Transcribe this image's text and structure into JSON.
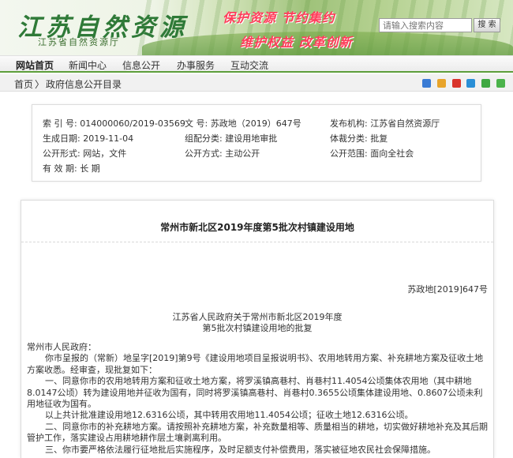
{
  "header": {
    "logo_text": "江苏自然资源",
    "logo_sub": "江苏省自然资源厅",
    "slogan_1": "保护资源  节约集约",
    "slogan_2": "维护权益  改革创新",
    "search_placeholder": "请输入搜索内容",
    "search_button": "搜 索"
  },
  "nav": {
    "items": [
      "网站首页",
      "新闻中心",
      "信息公开",
      "办事服务",
      "互动交流"
    ]
  },
  "breadcrumb": {
    "home": "首页",
    "separator": "〉",
    "current": "政府信息公开目录"
  },
  "colors": {
    "nav_underline": "#5d9e3b",
    "slogan": "#ff3d5a",
    "logo": "#2f7a38"
  },
  "meta": {
    "index_label": "索 引 号:",
    "index_value": "014000060/2019-03569",
    "doc_label": "文     号:",
    "doc_value": "苏政地（2019）647号",
    "publisher_label": "发布机构:",
    "publisher_value": "江苏省自然资源厅",
    "date_label": "生成日期:",
    "date_value": "2019-11-04",
    "category_label": "组配分类:",
    "category_value": "建设用地审批",
    "genre_label": "体裁分类:",
    "genre_value": "批复",
    "form_label": "公开形式:",
    "form_value": "网站，文件",
    "method_label": "公开方式:",
    "method_value": "主动公开",
    "scope_label": "公开范围:",
    "scope_value": "面向全社会",
    "validity_label": "有 效 期:",
    "validity_value": "长 期"
  },
  "document": {
    "title": "常州市新北区2019年度第5批次村镇建设用地",
    "number": "苏政地[2019]647号",
    "heading_1": "江苏省人民政府关于常州市新北区2019年度",
    "heading_2": "第5批次村镇建设用地的批复",
    "salutation": "常州市人民政府：",
    "para_1": "你市呈报的（常新）地呈字[2019]第9号《建设用地项目呈报说明书》、农用地转用方案、补充耕地方案及征收土地方案收悉。经审查，现批复如下：",
    "para_2": "一、同意你市的农用地转用方案和征收土地方案，将罗溪镇高巷村、肖巷村11.4054公顷集体农用地（其中耕地8.0147公顷）转为建设用地并征收为国有，同时将罗溪镇高巷村、肖巷村0.3655公顷集体建设用地、0.8607公顷未利用地征收为国有。",
    "para_3": "以上共计批准建设用地12.6316公顷，其中转用农用地11.4054公顷；征收土地12.6316公顷。",
    "para_4": "二、同意你市的补充耕地方案。请按照补充耕地方案，补充数量相等、质量相当的耕地，切实做好耕地补充及其后期管护工作，落实建设占用耕地耕作层土壤剥离利用。",
    "para_5": "三、你市要严格依法履行征地批后实施程序，及时足额支付补偿费用，落实被征地农民社会保障措施。"
  }
}
